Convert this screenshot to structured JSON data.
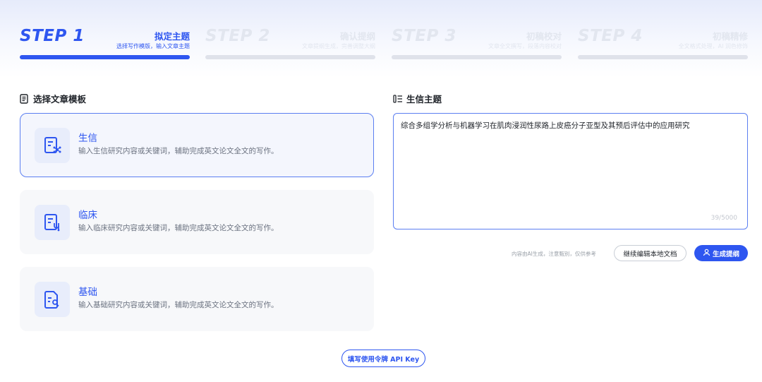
{
  "steps": [
    {
      "num": "STEP 1",
      "title": "拟定主题",
      "desc": "选择写作模版，输入文章主题",
      "state": "active"
    },
    {
      "num": "STEP 2",
      "title": "确认提纲",
      "desc": "文章提纲生成，完善调整大纲",
      "state": "inactive"
    },
    {
      "num": "STEP 3",
      "title": "初稿校对",
      "desc": "文章全文撰写，段落内容校对",
      "state": "inactive"
    },
    {
      "num": "STEP 4",
      "title": "初稿精修",
      "desc": "全文格式处理，AI 润色修饰",
      "state": "inactive"
    }
  ],
  "left": {
    "title": "选择文章模板",
    "icon": "document-icon",
    "cards": [
      {
        "title": "生信",
        "desc": "输入生信研究内容或关键词，辅助完成英文论文全文的写作。",
        "icon": "bioinformatics-icon",
        "selected": true
      },
      {
        "title": "临床",
        "desc": "输入临床研究内容或关键词，辅助完成英文论文全文的写作。",
        "icon": "clinical-icon",
        "selected": false
      },
      {
        "title": "基础",
        "desc": "输入基础研究内容或关键词，辅助完成英文论文全文的写作。",
        "icon": "basic-research-icon",
        "selected": false
      }
    ]
  },
  "right": {
    "title": "生信主题",
    "icon": "list-icon",
    "topic_value": "综合多组学分析与机器学习在肌肉浸润性尿路上皮癌分子亚型及其预后评估中的应用研究",
    "counter": "39/5000",
    "note": "内容由AI生成，注意甄别，仅供参考",
    "continue_label": "继续编辑本地文档",
    "generate_label": "生成提纲",
    "generate_icon": "user-doc-icon"
  },
  "api_key_label": "填写使用令牌 API Key",
  "colors": {
    "accent": "#2e56f0",
    "inactive": "#e2e6ef",
    "card_bg": "#f7f8fa"
  }
}
